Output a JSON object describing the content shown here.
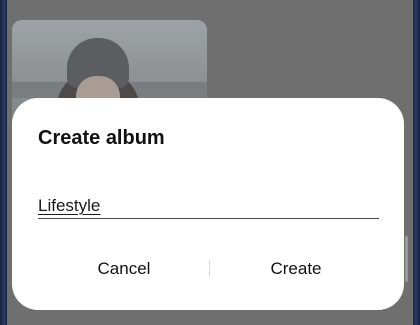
{
  "dialog": {
    "title": "Create album",
    "album_name_value": "Lifestyle",
    "cancel_label": "Cancel",
    "create_label": "Create"
  },
  "colors": {
    "dialog_background": "#ffffff",
    "scrim": "#6f6f70",
    "text": "#111111"
  }
}
